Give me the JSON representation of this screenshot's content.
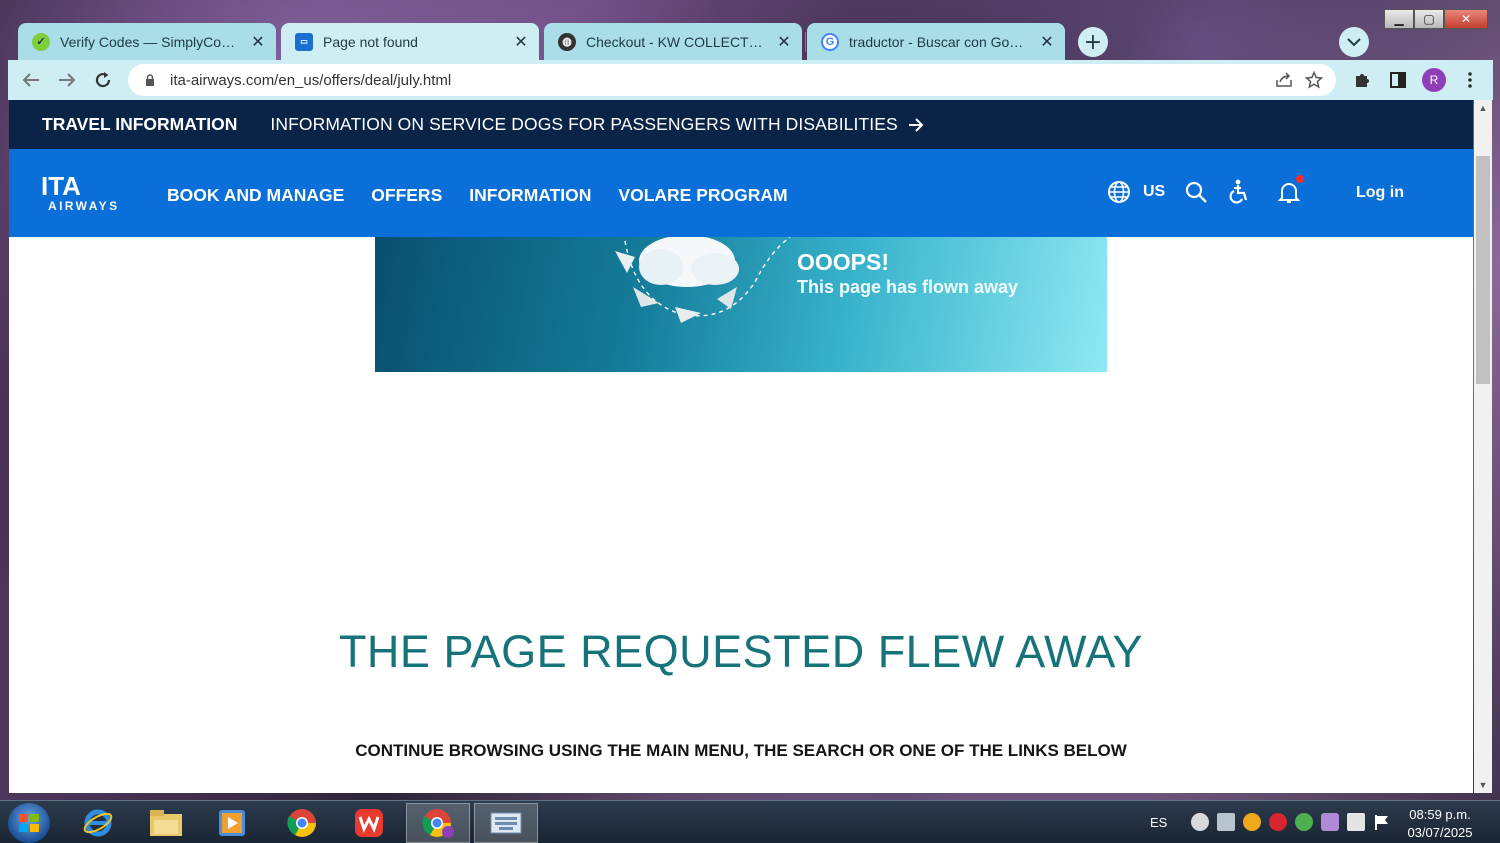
{
  "browser": {
    "tabs": [
      {
        "label": "Verify Codes — SimplyCodes",
        "favicon_color": "#7ccf3a"
      },
      {
        "label": "Page not found",
        "favicon_color": "#1a6fd0",
        "active": true
      },
      {
        "label": "Checkout - KW COLLECTIONS",
        "favicon_color": "#333333"
      },
      {
        "label": "traductor - Buscar con Google",
        "favicon_color": "#4285f4"
      }
    ],
    "close_glyph": "✕",
    "url": "ita-airways.com/en_us/offers/deal/july.html",
    "profile_initial": "R"
  },
  "page": {
    "topbar": {
      "title": "TRAVEL INFORMATION",
      "notice": "INFORMATION ON SERVICE DOGS FOR PASSENGERS WITH DISABILITIES"
    },
    "nav": {
      "logo_top": "ITA",
      "logo_bottom": "AIRWAYS",
      "links": [
        "BOOK AND MANAGE",
        "OFFERS",
        "INFORMATION",
        "VOLARE PROGRAM"
      ],
      "locale": "US",
      "login": "Log in"
    },
    "banner": {
      "title": "OOOPS!",
      "subtitle": "This page has flown away"
    },
    "error": {
      "heading": "THE PAGE REQUESTED FLEW AWAY",
      "subheading": "CONTINUE BROWSING USING THE MAIN MENU, THE SEARCH OR ONE OF THE LINKS BELOW"
    }
  },
  "taskbar": {
    "language": "ES",
    "time": "08:59 p.m.",
    "date": "03/07/2025"
  },
  "colors": {
    "brand_blue": "#0a6fd8",
    "navy": "#0a2447",
    "heading_teal": "#17737a"
  }
}
